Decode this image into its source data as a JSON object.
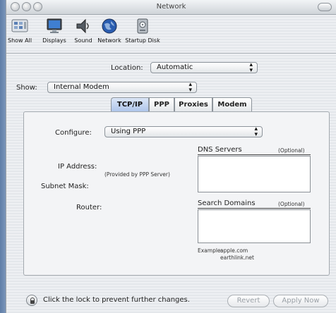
{
  "window": {
    "title": "Network"
  },
  "toolbar": {
    "items": [
      {
        "label": "Show All",
        "icon": "show-all-icon"
      },
      {
        "label": "Displays",
        "icon": "display-icon"
      },
      {
        "label": "Sound",
        "icon": "speaker-icon"
      },
      {
        "label": "Network",
        "icon": "network-globe-icon"
      },
      {
        "label": "Startup Disk",
        "icon": "disk-icon"
      }
    ]
  },
  "location": {
    "label": "Location:",
    "value": "Automatic"
  },
  "show": {
    "label": "Show:",
    "value": "Internal Modem"
  },
  "tabs": [
    {
      "label": "TCP/IP",
      "selected": true
    },
    {
      "label": "PPP",
      "selected": false
    },
    {
      "label": "Proxies",
      "selected": false
    },
    {
      "label": "Modem",
      "selected": false
    }
  ],
  "tcpip": {
    "configure_label": "Configure:",
    "configure_value": "Using PPP",
    "ip_address_label": "IP Address:",
    "ip_note": "(Provided by PPP Server)",
    "subnet_label": "Subnet Mask:",
    "router_label": "Router:",
    "dns_label": "DNS Servers",
    "dns_optional": "(Optional)",
    "search_label": "Search Domains",
    "search_optional": "(Optional)",
    "example_label": "Example:",
    "example_line1": "apple.com",
    "example_line2": "earthlink.net"
  },
  "footer": {
    "lock_text": "Click the lock to prevent further changes.",
    "revert_label": "Revert",
    "apply_label": "Apply Now"
  },
  "colors": {
    "selected_tab": "#aec5ea",
    "disabled_text": "#9aa0a6"
  }
}
